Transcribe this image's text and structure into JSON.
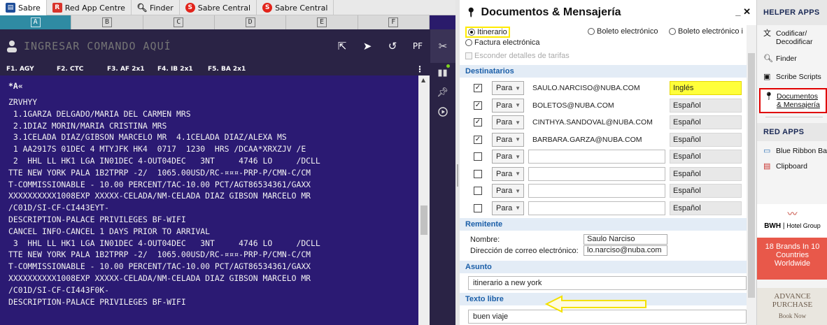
{
  "tabs": [
    {
      "label": "Sabre",
      "icon": "sabre-icon",
      "color": "#1f4e99"
    },
    {
      "label": "Red App Centre",
      "icon": "red-app-icon",
      "color": "#d9342b"
    },
    {
      "label": "Finder",
      "icon": "search-icon",
      "color": "#333333"
    },
    {
      "label": "Sabre Central",
      "icon": "sabre-central-icon",
      "color": "#e2231a"
    },
    {
      "label": "Sabre Central",
      "icon": "sabre-central-icon",
      "color": "#e2231a"
    }
  ],
  "areas": [
    "A",
    "B",
    "C",
    "D",
    "E",
    "F"
  ],
  "command": {
    "placeholder": "INGRESAR COMANDO AQUÍ",
    "pf_label": "PF"
  },
  "fkeys": [
    "F1. AGY",
    "F2. CTC",
    "F3. AF 2x1",
    "F4. IB 2x1",
    "F5. BA 2x1"
  ],
  "terminal": {
    "prompt": "*A«",
    "lines": [
      "ZRVHYY",
      " 1.1GARZA DELGADO/MARIA DEL CARMEN MRS",
      " 2.1DIAZ MORIN/MARIA CRISTINA MRS",
      " 3.1CELADA DIAZ/GIBSON MARCELO MR  4.1CELADA DIAZ/ALEXA MS",
      " 1 AA2917S 01DEC 4 MTYJFK HK4  0717  1230  HRS /DCAA*XRXZJV /E",
      " 2  HHL LL HK1 LGA IN01DEC 4-OUT04DEC   3NT     4746 LO     /DCLL",
      "TTE NEW YORK PALA 1B2TPRP -2/  1065.00USD/RC-¤¤¤-PRP-P/CMN-C/CM",
      "T-COMMISSIONABLE - 10.00 PERCENT/TAC-10.00 PCT/AGT86534361/GAXX",
      "XXXXXXXXXX1008EXP XXXXX-CELADA/NM-CELADA DIAZ GIBSON MARCELO MR",
      "/C01D/SI-CF-CI443EYT-",
      "DESCRIPTION-PALACE PRIVILEGES BF-WIFI",
      "CANCEL INFO-CANCEL 1 DAYS PRIOR TO ARRIVAL",
      " 3  HHL LL HK1 LGA IN01DEC 4-OUT04DEC   3NT     4746 LO     /DCLL",
      "TTE NEW YORK PALA 1B2TPRP -2/  1065.00USD/RC-¤¤¤-PRP-P/CMN-C/CM",
      "T-COMMISSIONABLE - 10.00 PERCENT/TAC-10.00 PCT/AGT86534361/GAXX",
      "XXXXXXXXXX1008EXP XXXXX-CELADA/NM-CELADA DIAZ GIBSON MARCELO MR",
      "/C01D/SI-CF-CI443F0K-",
      "DESCRIPTION-PALACE PRIVILEGES BF-WIFI"
    ]
  },
  "panel": {
    "title": "Documentos & Mensajería",
    "doc_types": [
      "Itinerario",
      "Boleto electrónico",
      "Boleto electrónico i"
    ],
    "selected_doc": "Itinerario",
    "invoice": "Factura electrónica",
    "hide_fares": "Esconder detalles de tarifas",
    "section_recipients": "Destinatarios",
    "recipients": [
      {
        "checked": true,
        "mode": "Para",
        "email": "SAULO.NARCISO@NUBA.COM",
        "lang": "Inglés",
        "highlight": true
      },
      {
        "checked": true,
        "mode": "Para",
        "email": "BOLETOS@NUBA.COM",
        "lang": "Español",
        "highlight": false
      },
      {
        "checked": true,
        "mode": "Para",
        "email": "CINTHYA.SANDOVAL@NUBA.COM",
        "lang": "Español",
        "highlight": false
      },
      {
        "checked": true,
        "mode": "Para",
        "email": "BARBARA.GARZA@NUBA.COM",
        "lang": "Español",
        "highlight": false
      },
      {
        "checked": false,
        "mode": "Para",
        "email": "",
        "lang": "Español",
        "highlight": false
      },
      {
        "checked": false,
        "mode": "Para",
        "email": "",
        "lang": "Español",
        "highlight": false
      },
      {
        "checked": false,
        "mode": "Para",
        "email": "",
        "lang": "Español",
        "highlight": false
      },
      {
        "checked": false,
        "mode": "Para",
        "email": "",
        "lang": "Español",
        "highlight": false
      }
    ],
    "section_sender": "Remitente",
    "name_label": "Nombre:",
    "name_value": "Saulo Narciso",
    "email_label": "Dirección de correo electrónico:",
    "email_value": "lo.narciso@nuba.com",
    "section_subject": "Asunto",
    "subject_value": "itinerario a new york",
    "section_free_text": "Texto libre",
    "free_text_value": "buen viaje"
  },
  "helper": {
    "title": "HELPER APPS",
    "items": [
      {
        "label": "Codificar/ Decodificar",
        "icon": "translate-icon"
      },
      {
        "label": "Finder",
        "icon": "search-icon"
      },
      {
        "label": "Scribe Scripts",
        "icon": "script-icon"
      },
      {
        "label": "Documentos & Mensajería",
        "icon": "pin-icon",
        "active": true
      }
    ],
    "red_title": "RED APPS",
    "red_items": [
      {
        "label": "Blue Ribbon Bag",
        "icon": "ribbon-icon"
      },
      {
        "label": "Clipboard",
        "icon": "clipboard-icon"
      }
    ],
    "ad1": {
      "brand": "BWH",
      "group": "Hotel Group",
      "line1": "18 Brands In 10",
      "line2": "Countries",
      "line3": "Worldwide"
    },
    "ad2": {
      "line1": "ADVANCE",
      "line2": "PURCHASE",
      "line3": "Book Now"
    }
  },
  "colors": {
    "terminal_bg": "#2b1a73",
    "highlight": "#ffff3a",
    "active_border": "#e00000",
    "section_text": "#1a5ea8"
  }
}
